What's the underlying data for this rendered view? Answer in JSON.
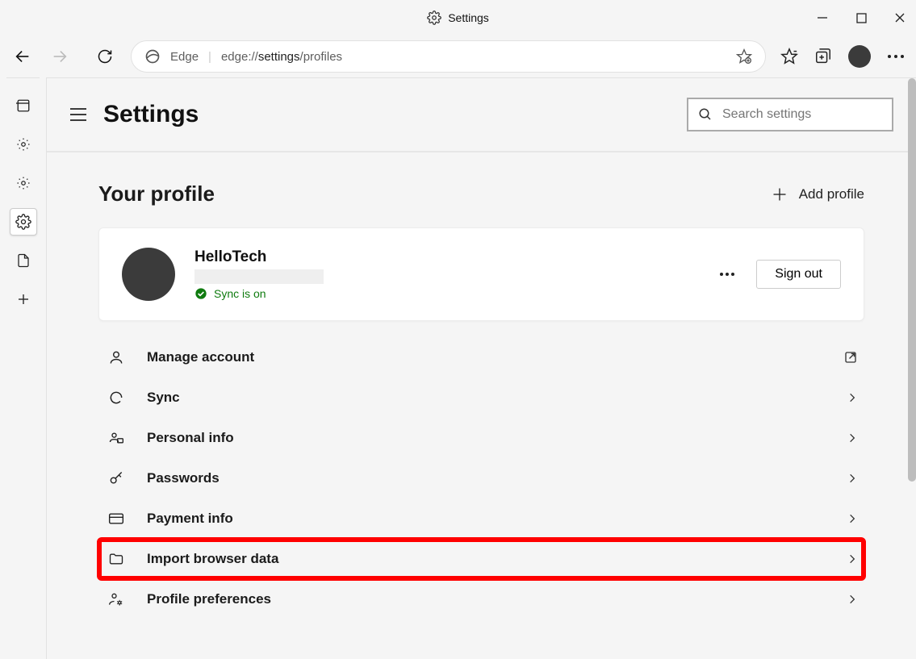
{
  "titlebar": {
    "label": "Settings"
  },
  "toolbar": {
    "edge_label": "Edge",
    "url_prefix": "edge://",
    "url_bold": "settings",
    "url_suffix": "/profiles"
  },
  "settings": {
    "title": "Settings",
    "search_placeholder": "Search settings"
  },
  "section": {
    "title": "Your profile",
    "add_profile": "Add profile"
  },
  "profile": {
    "name": "HelloTech",
    "sync": "Sync is on",
    "signout": "Sign out"
  },
  "menu": {
    "manage": "Manage account",
    "sync": "Sync",
    "personal": "Personal info",
    "passwords": "Passwords",
    "payment": "Payment info",
    "import": "Import browser data",
    "prefs": "Profile preferences"
  }
}
